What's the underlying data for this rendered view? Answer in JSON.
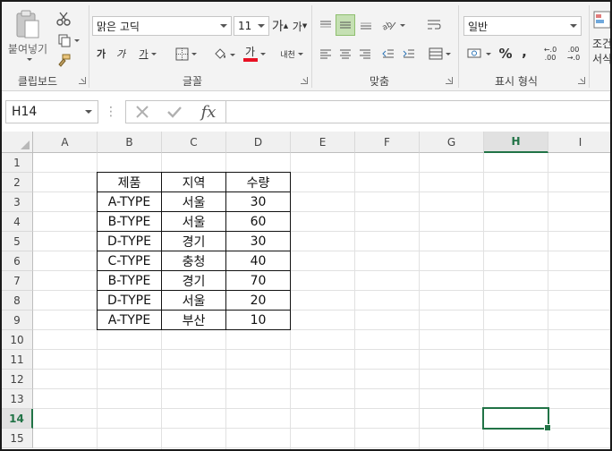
{
  "ribbon": {
    "clipboard": {
      "paste_label": "붙여넣기",
      "group_label": "클립보드"
    },
    "font": {
      "font_name": "맑은 고딕",
      "font_size": "11",
      "grow_label": "가",
      "shrink_label": "가",
      "bold_label": "가",
      "italic_label": "가",
      "underline_label": "가",
      "font_color_label": "가",
      "phonetic_label": "내천",
      "group_label": "글꼴",
      "font_color_hex": "#e81123"
    },
    "alignment": {
      "group_label": "맞춤"
    },
    "number": {
      "format": "일반",
      "percent_label": "%",
      "comma_label": ",",
      "inc_decimal_label": ".00",
      "dec_decimal_label": ".00",
      "group_label": "표시 형식"
    },
    "styles": {
      "cond_label_1": "조건",
      "cond_label_2": "서식"
    }
  },
  "formula_bar": {
    "name_box": "H14",
    "fx_label": "fx",
    "formula": ""
  },
  "sheet": {
    "columns": [
      "A",
      "B",
      "C",
      "D",
      "E",
      "F",
      "G",
      "H",
      "I"
    ],
    "rows": [
      "1",
      "2",
      "3",
      "4",
      "5",
      "6",
      "7",
      "8",
      "9",
      "10",
      "11",
      "12",
      "13",
      "14",
      "15"
    ],
    "selected_col": "H",
    "selected_row": "14",
    "table": {
      "header": [
        "제품",
        "지역",
        "수량"
      ],
      "rows": [
        [
          "A-TYPE",
          "서울",
          "30"
        ],
        [
          "B-TYPE",
          "서울",
          "60"
        ],
        [
          "D-TYPE",
          "경기",
          "30"
        ],
        [
          "C-TYPE",
          "충청",
          "40"
        ],
        [
          "B-TYPE",
          "경기",
          "70"
        ],
        [
          "D-TYPE",
          "서울",
          "20"
        ],
        [
          "A-TYPE",
          "부산",
          "10"
        ]
      ]
    },
    "accent_hex": "#217346"
  }
}
